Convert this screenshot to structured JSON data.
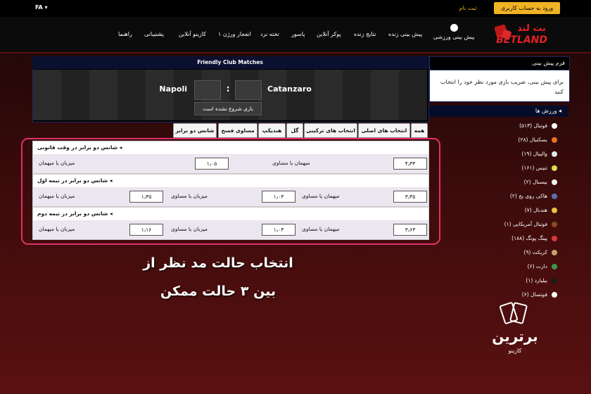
{
  "topbar": {
    "login_label": "ورود به حساب کاربری",
    "register_label": "ثبت نام",
    "lang_label": "FA ▾"
  },
  "nav": {
    "logo_text_fa": "بت لند",
    "logo_text_en": "BETLAND",
    "sports_prediction": "پیش بینی ورزشی",
    "items": [
      "پیش بینی زنده",
      "نتایج زنده",
      "پوکر آنلاین",
      "پاسور",
      "تخته نرد",
      "انفجار",
      "انفجار ورژن ۱",
      "کازینو آنلاین",
      "پشتیبانی",
      "راهنما"
    ]
  },
  "sidebar": {
    "form_title": "فرم پیش بینی",
    "form_text": "برای پیش بینی، ضریب بازی مورد نظر خود را انتخاب کنید",
    "sports_title": "ورزش ها ◂",
    "sports": [
      {
        "label": "فوتبال (۵۱۳)",
        "color": "#ffffff"
      },
      {
        "label": "بسکتبال (۲۸)",
        "color": "#e8732a"
      },
      {
        "label": "والیبال (۱۹)",
        "color": "#dfe6f0"
      },
      {
        "label": "تنیس (۱۶۱)",
        "color": "#d8e04a"
      },
      {
        "label": "بیسبال (۲)",
        "color": "#f2f2f2"
      },
      {
        "label": "هاکی روی یخ (۲)",
        "color": "#5a6fb0"
      },
      {
        "label": "هندبال (۷)",
        "color": "#e8c43a"
      },
      {
        "label": "فوتبال آمریکایی (۱)",
        "color": "#8b4a1f"
      },
      {
        "label": "پینگ پونگ (۱۸۸)",
        "color": "#d63a3a"
      },
      {
        "label": "کریکت (۹)",
        "color": "#c9a06a"
      },
      {
        "label": "دارت (۶)",
        "color": "#3a9a4a"
      },
      {
        "label": "بیلیارد (۱)",
        "color": "#1a1a1a"
      },
      {
        "label": "فوتسال (۶)",
        "color": "#ffffff"
      }
    ]
  },
  "match": {
    "title": "Friendly Club Matches",
    "home": "Napoli",
    "away": "Catanzaro",
    "score_sep": ":",
    "status": "بازی شروع نشده است"
  },
  "tabs": [
    "همه",
    "انتخاب های اصلی",
    "انتخاب های ترکیبی",
    "گل",
    "هندیکپ",
    "مساوی فسخ",
    "شانس دو برابر"
  ],
  "markets": [
    {
      "title": "شانس دو برابر در وقت قانونی ◂",
      "cells": [
        {
          "label": "میهمان یا مساوی",
          "odd": "۴٫۳۳"
        },
        {
          "label": "میزبان یا میهمان",
          "odd": "۱٫۰۵"
        }
      ]
    },
    {
      "title": "شانس دو برابر در نیمه اول ◂",
      "cells": [
        {
          "label": "میهمان یا مساوی",
          "odd": "۳٫۳۵"
        },
        {
          "label": "میزبان یا مساوی",
          "odd": "۱٫۰۳"
        },
        {
          "label": "میزبان یا میهمان",
          "odd": "۱٫۳۵"
        }
      ]
    },
    {
      "title": "شانس دو برابر در نیمه دوم ◂",
      "cells": [
        {
          "label": "میهمان یا مساوی",
          "odd": "۳٫۶۳"
        },
        {
          "label": "میزبان یا مساوی",
          "odd": "۱٫۰۳"
        },
        {
          "label": "میزبان یا میهمان",
          "odd": "۱٫۱۶"
        }
      ]
    }
  ],
  "caption": {
    "line1": "انتخاب حالت مد نظر از",
    "line2": "بین ۳ حالت ممکن"
  },
  "watermark": {
    "title": "برترین",
    "subtitle": "کازینو"
  },
  "colors": {
    "accent": "#f0b323",
    "brand_red": "#e32222",
    "highlight": "#e0306a",
    "navy": "#0a1030"
  }
}
